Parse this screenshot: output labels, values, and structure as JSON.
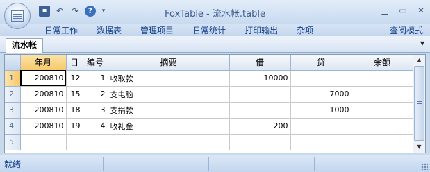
{
  "window": {
    "title": "FoxTable - 流水帐.table",
    "quick_access": [
      "save-icon",
      "undo-icon",
      "redo-icon",
      "help-icon",
      "customize-dropdown-icon"
    ],
    "buttons": [
      "minimize",
      "maximize",
      "close"
    ]
  },
  "menu": {
    "items": [
      "日常工作",
      "数据表",
      "管理项目",
      "日常统计",
      "打印输出",
      "杂项"
    ],
    "right_item": "查阅模式"
  },
  "tabs": {
    "active": "流水帐"
  },
  "grid": {
    "columns": [
      "年月",
      "日",
      "编号",
      "摘要",
      "借",
      "贷",
      "余额"
    ],
    "rows": [
      {
        "row": "1",
        "cells": [
          "200810",
          "12",
          "1",
          "收取款",
          "10000",
          "",
          ""
        ]
      },
      {
        "row": "2",
        "cells": [
          "200810",
          "15",
          "2",
          "支电脑",
          "",
          "7000",
          ""
        ]
      },
      {
        "row": "3",
        "cells": [
          "200810",
          "18",
          "3",
          "支捐款",
          "",
          "1000",
          ""
        ]
      },
      {
        "row": "4",
        "cells": [
          "200810",
          "19",
          "4",
          "收礼金",
          "200",
          "",
          ""
        ]
      },
      {
        "row": "5",
        "cells": [
          "",
          "",
          "",
          "",
          "",
          "",
          ""
        ]
      }
    ]
  },
  "status": {
    "text": "就绪"
  },
  "colors": {
    "accent": "#15428b",
    "ribbon_bg": "#c9d9ec",
    "selection": "#f7c86a"
  }
}
